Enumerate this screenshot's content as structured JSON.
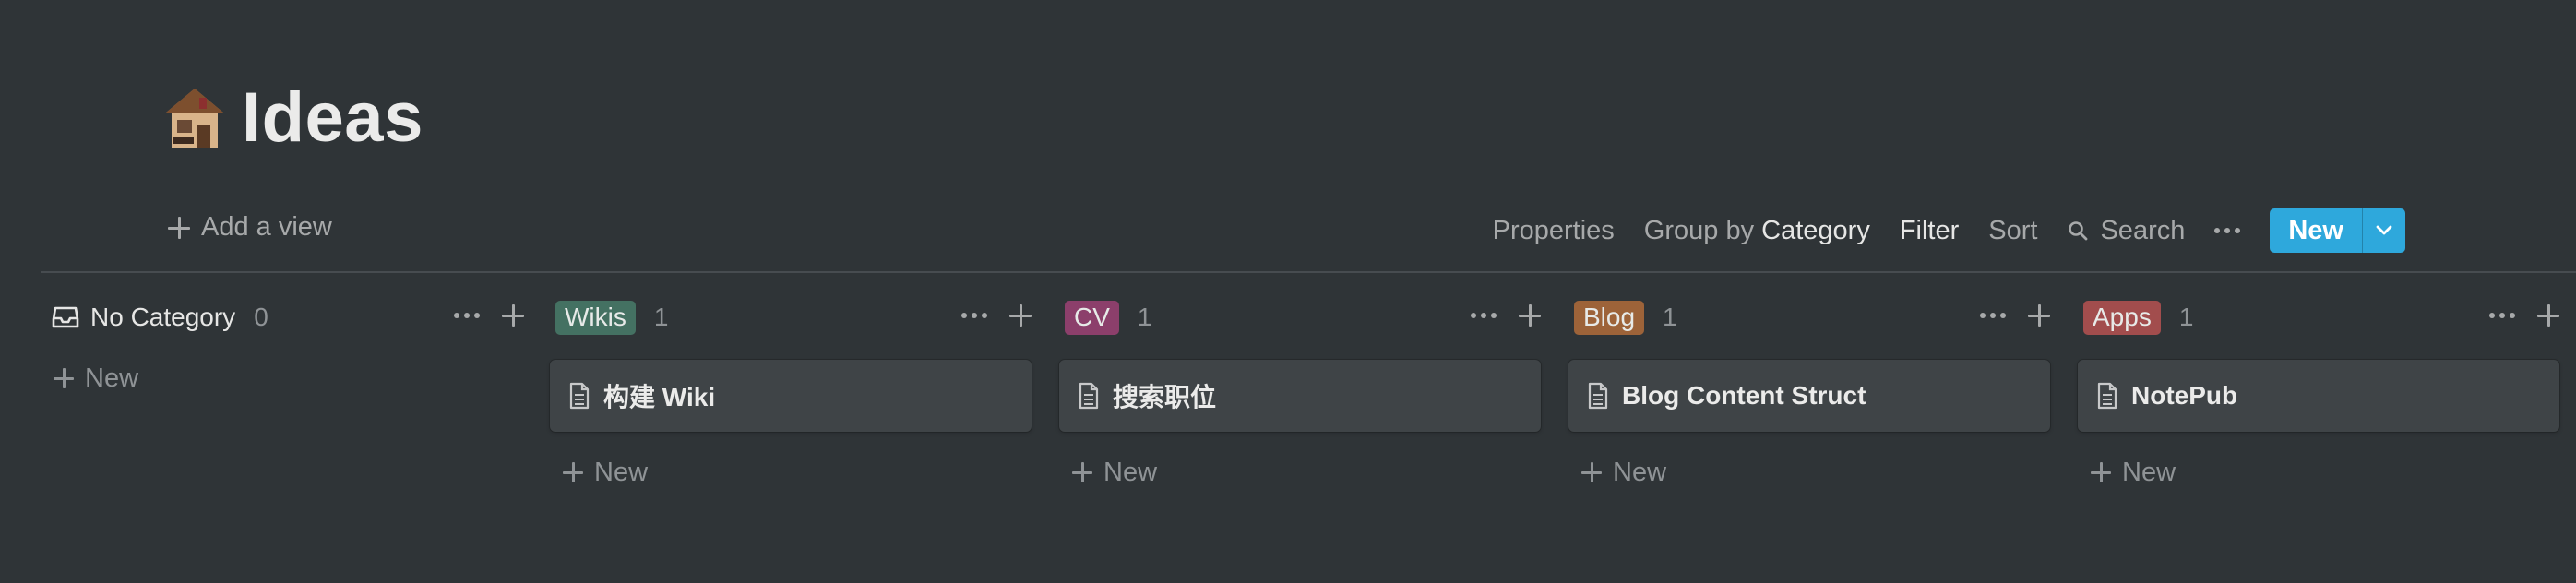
{
  "page": {
    "title": "Ideas",
    "icon": "house-emoji-icon"
  },
  "views": {
    "add_view_label": "Add a view"
  },
  "toolbar": {
    "properties_label": "Properties",
    "group_by_prefix": "Group by",
    "group_by_value": "Category",
    "filter_label": "Filter",
    "sort_label": "Sort",
    "search_label": "Search",
    "new_label": "New"
  },
  "colors": {
    "background": "#2f3437",
    "accent": "#2ea8dc",
    "tag_wikis": "#447162",
    "tag_cv": "#8c3f6b",
    "tag_blog": "#9d6339",
    "tag_apps": "#a24d4d"
  },
  "columns": [
    {
      "name": "No Category",
      "count": "0",
      "cards": [],
      "new_label": "New"
    },
    {
      "name": "Wikis",
      "count": "1",
      "cards": [
        {
          "title": "构建 Wiki"
        }
      ],
      "new_label": "New"
    },
    {
      "name": "CV",
      "count": "1",
      "cards": [
        {
          "title": "搜索职位"
        }
      ],
      "new_label": "New"
    },
    {
      "name": "Blog",
      "count": "1",
      "cards": [
        {
          "title": "Blog Content Struct"
        }
      ],
      "new_label": "New"
    },
    {
      "name": "Apps",
      "count": "1",
      "cards": [
        {
          "title": "NotePub"
        }
      ],
      "new_label": "New"
    }
  ]
}
